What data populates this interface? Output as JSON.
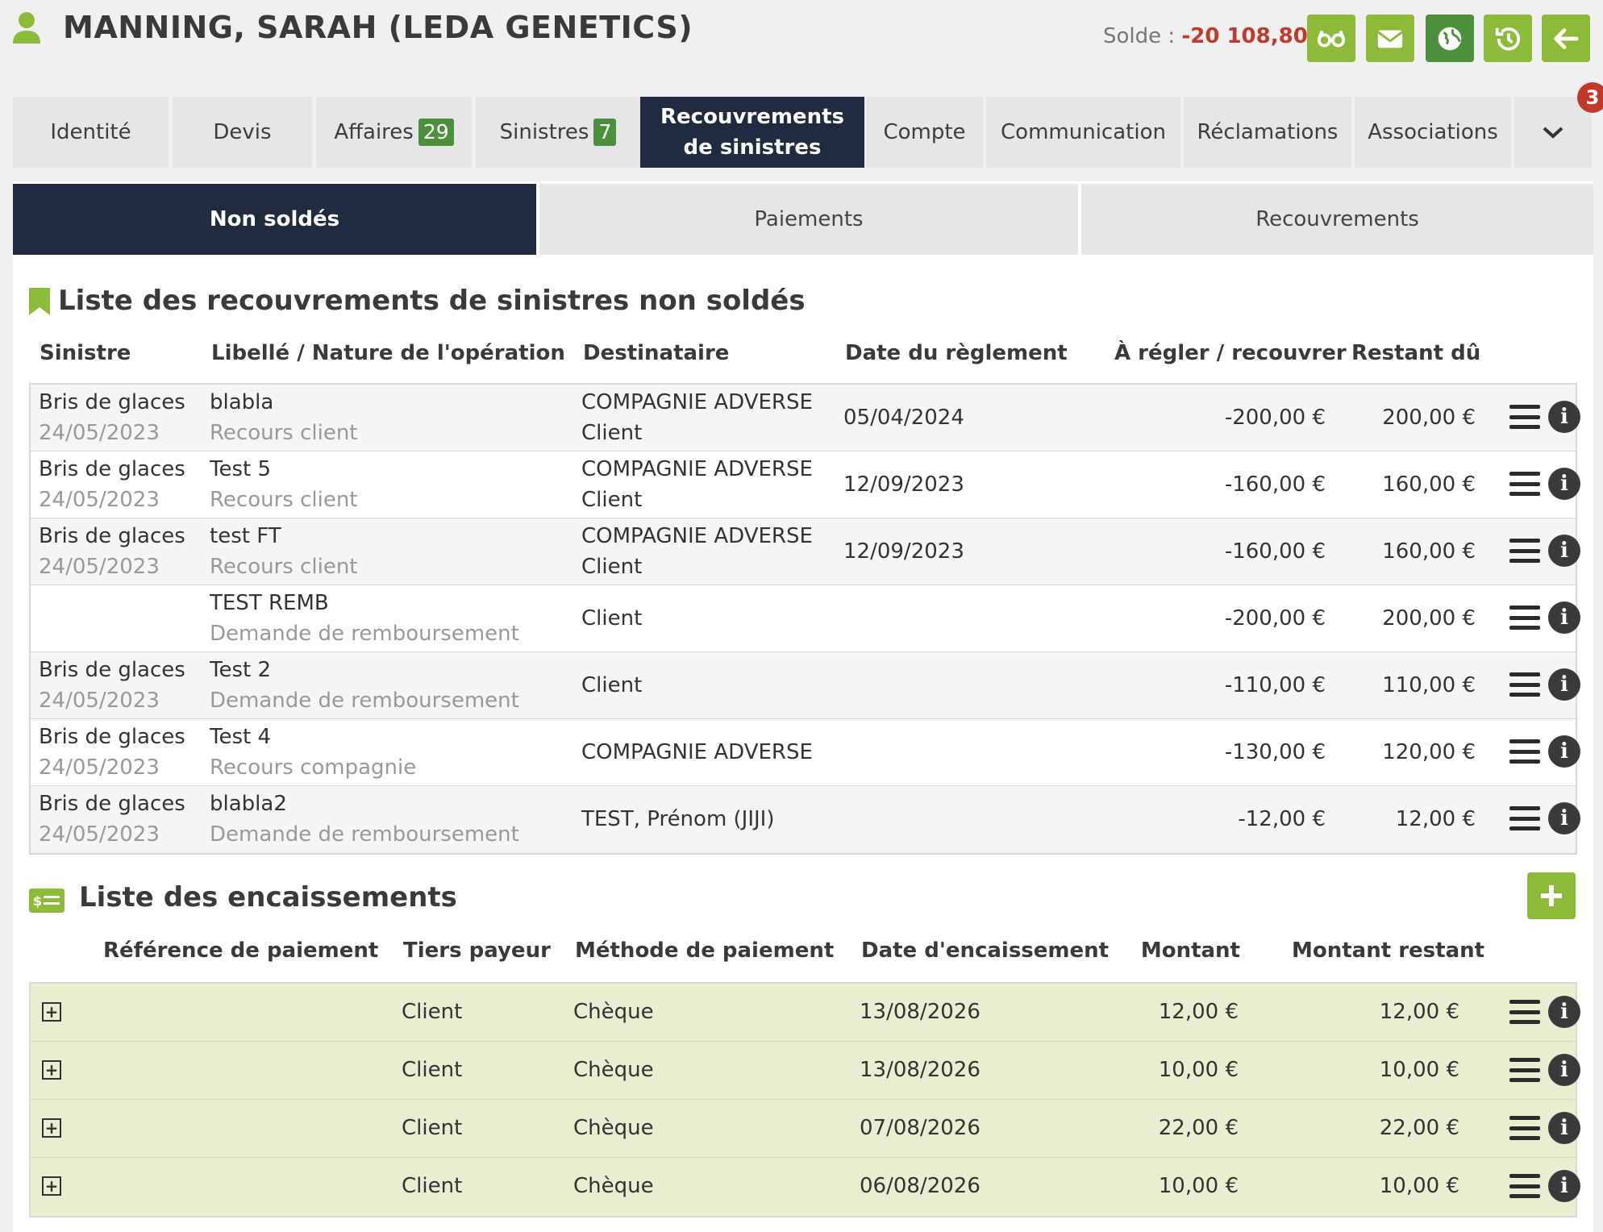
{
  "header": {
    "title": "MANNING, SARAH (LEDA GENETICS)",
    "solde_label": "Solde : ",
    "solde_value": "-20 108,80 €",
    "buttons": [
      "glasses-icon",
      "mail-icon",
      "globe-icon",
      "history-icon",
      "arrow-left-icon"
    ],
    "accent_color": "#8cbb3a",
    "dark_green": "#4c8f3d",
    "negative_color": "#c0392b"
  },
  "tabs": [
    {
      "label": "Identité"
    },
    {
      "label": "Devis"
    },
    {
      "label": "Affaires",
      "badge": "29"
    },
    {
      "label": "Sinistres",
      "badge": "7"
    },
    {
      "label": "Recouvrements",
      "label2": "de sinistres",
      "active": true
    },
    {
      "label": "Compte"
    },
    {
      "label": "Communication"
    },
    {
      "label": "Réclamations"
    },
    {
      "label": "Associations"
    }
  ],
  "notification_count": "3",
  "subtabs": [
    "Non soldés",
    "Paiements",
    "Recouvrements"
  ],
  "recouvrements": {
    "title": "Liste des recouvrements de sinistres non soldés",
    "headers": [
      "Sinistre",
      "Libellé / Nature de l'opération",
      "Destinataire",
      "Date du règlement",
      "À régler / recouvrer",
      "Restant dû"
    ],
    "rows": [
      {
        "sinistre": "Bris de glaces",
        "sinistre_date": "24/05/2023",
        "libelle": "blabla",
        "nature": "Recours client",
        "dest1": "COMPAGNIE ADVERSE",
        "dest2": "Client",
        "date": "05/04/2024",
        "a_regler": "-200,00 €",
        "restant": "200,00 €"
      },
      {
        "sinistre": "Bris de glaces",
        "sinistre_date": "24/05/2023",
        "libelle": "Test 5",
        "nature": "Recours client",
        "dest1": "COMPAGNIE ADVERSE",
        "dest2": "Client",
        "date": "12/09/2023",
        "a_regler": "-160,00 €",
        "restant": "160,00 €"
      },
      {
        "sinistre": "Bris de glaces",
        "sinistre_date": "24/05/2023",
        "libelle": "test FT",
        "nature": "Recours client",
        "dest1": "COMPAGNIE ADVERSE",
        "dest2": "Client",
        "date": "12/09/2023",
        "a_regler": "-160,00 €",
        "restant": "160,00 €"
      },
      {
        "sinistre": "",
        "sinistre_date": "",
        "libelle": "TEST REMB",
        "nature": "Demande de remboursement",
        "dest1": "Client",
        "dest2": "",
        "date": "",
        "a_regler": "-200,00 €",
        "restant": "200,00 €"
      },
      {
        "sinistre": "Bris de glaces",
        "sinistre_date": "24/05/2023",
        "libelle": "Test 2",
        "nature": "Demande de remboursement",
        "dest1": "Client",
        "dest2": "",
        "date": "",
        "a_regler": "-110,00 €",
        "restant": "110,00 €"
      },
      {
        "sinistre": "Bris de glaces",
        "sinistre_date": "24/05/2023",
        "libelle": "Test 4",
        "nature": "Recours compagnie",
        "dest1": "COMPAGNIE ADVERSE",
        "dest2": "",
        "date": "",
        "a_regler": "-130,00 €",
        "restant": "120,00 €"
      },
      {
        "sinistre": "Bris de glaces",
        "sinistre_date": "24/05/2023",
        "libelle": "blabla2",
        "nature": "Demande de remboursement",
        "dest1": "TEST, Prénom (JIJI)",
        "dest2": "",
        "date": "",
        "a_regler": "-12,00 €",
        "restant": "12,00 €"
      }
    ]
  },
  "encaissements": {
    "title": "Liste des encaissements",
    "headers": [
      "Référence de paiement",
      "Tiers payeur",
      "Méthode de paiement",
      "Date d'encaissement",
      "Montant",
      "Montant restant"
    ],
    "rows": [
      {
        "reference": "",
        "tiers": "Client",
        "methode": "Chèque",
        "date": "13/08/2026",
        "montant": "12,00 €",
        "restant": "12,00 €"
      },
      {
        "reference": "",
        "tiers": "Client",
        "methode": "Chèque",
        "date": "13/08/2026",
        "montant": "10,00 €",
        "restant": "10,00 €"
      },
      {
        "reference": "",
        "tiers": "Client",
        "methode": "Chèque",
        "date": "07/08/2026",
        "montant": "22,00 €",
        "restant": "22,00 €"
      },
      {
        "reference": "",
        "tiers": "Client",
        "methode": "Chèque",
        "date": "06/08/2026",
        "montant": "10,00 €",
        "restant": "10,00 €"
      }
    ]
  }
}
